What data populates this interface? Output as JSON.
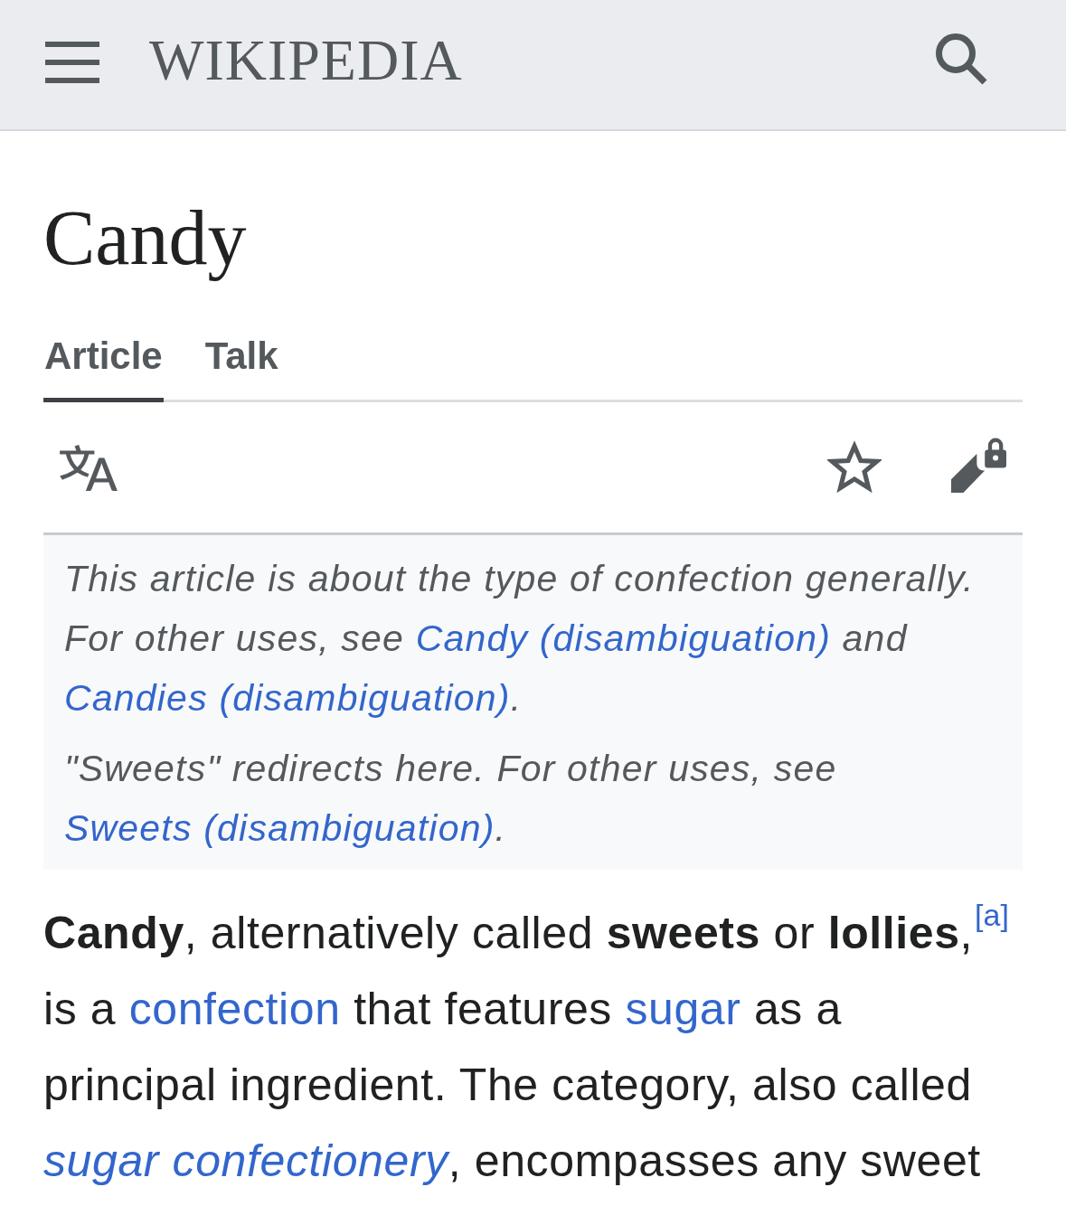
{
  "header": {
    "wordmark": "WIKIPEDIA"
  },
  "page_title": "Candy",
  "tabs": [
    {
      "label": "Article",
      "selected": true
    },
    {
      "label": "Talk",
      "selected": false
    }
  ],
  "hatnotes": [
    {
      "segments": [
        {
          "kind": "text",
          "text": "This article is about the type of confection generally. For other uses, see "
        },
        {
          "kind": "link",
          "text": "Candy (disambiguation)"
        },
        {
          "kind": "text",
          "text": " and "
        },
        {
          "kind": "link",
          "text": "Candies (disambiguation)"
        },
        {
          "kind": "text",
          "text": "."
        }
      ]
    },
    {
      "segments": [
        {
          "kind": "text",
          "text": "\"Sweets\" redirects here. For other uses, see "
        },
        {
          "kind": "link",
          "text": "Sweets (disambiguation)"
        },
        {
          "kind": "text",
          "text": "."
        }
      ]
    }
  ],
  "lead": {
    "segments": [
      {
        "kind": "text",
        "text": "**Candy**, alternatively called **sweets** or **lollies**,"
      },
      {
        "kind": "ref",
        "text": "[a]"
      },
      {
        "kind": "text",
        "text": " is a "
      },
      {
        "kind": "link",
        "text": "confection"
      },
      {
        "kind": "text",
        "text": " that features "
      },
      {
        "kind": "link",
        "text": "sugar"
      },
      {
        "kind": "text",
        "text": " as a principal ingredient. The category, also called "
      },
      {
        "kind": "italic_link",
        "text": "sugar confectionery"
      },
      {
        "kind": "text",
        "text": ", encompasses any sweet"
      }
    ]
  }
}
